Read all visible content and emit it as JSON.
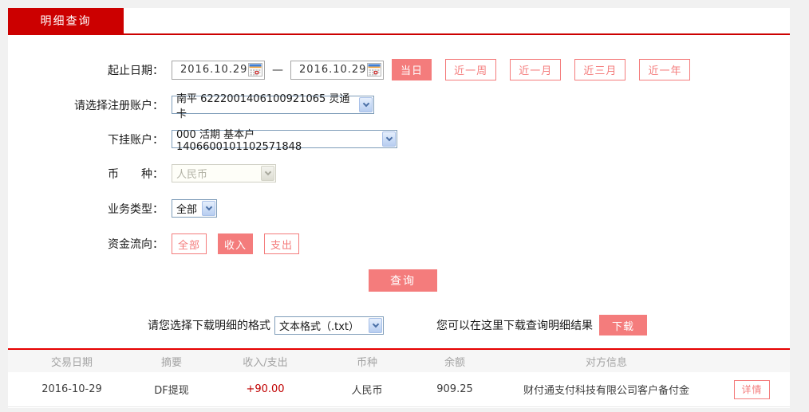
{
  "colors": {
    "brand_red": "#cc0000",
    "accent_pink": "#f47c7c",
    "income_red": "#c00000"
  },
  "tab": {
    "label": "明细查询"
  },
  "form": {
    "date": {
      "label": "起止日期：",
      "from": "2016.10.29",
      "to": "2016.10.29",
      "separator": "—"
    },
    "quick_ranges": [
      {
        "label": "当日",
        "active": true
      },
      {
        "label": "近一周",
        "active": false
      },
      {
        "label": "近一月",
        "active": false
      },
      {
        "label": "近三月",
        "active": false
      },
      {
        "label": "近一年",
        "active": false
      }
    ],
    "register_account": {
      "label": "请选择注册账户：",
      "value": "南平 6222001406100921065 灵通卡"
    },
    "sub_account": {
      "label": "下挂账户：",
      "value": "000 活期 基本户 1406600101102571848"
    },
    "currency": {
      "label": "币　　种：",
      "value": "人民币",
      "disabled": true
    },
    "business_type": {
      "label": "业务类型：",
      "value": "全部"
    },
    "fund_flow": {
      "label": "资金流向：",
      "options": [
        {
          "label": "全部",
          "active": false
        },
        {
          "label": "收入",
          "active": true
        },
        {
          "label": "支出",
          "active": false
        }
      ]
    },
    "query_button": "查询"
  },
  "download": {
    "format_label": "请您选择下载明细的格式",
    "format_value": "文本格式（.txt）",
    "hint": "您可以在这里下载查询明细结果",
    "button": "下载"
  },
  "table": {
    "headers": [
      "交易日期",
      "摘要",
      "收入/支出",
      "币种",
      "余额",
      "对方信息"
    ],
    "rows": [
      {
        "date": "2016-10-29",
        "summary": "DF提现",
        "amount": "+90.00",
        "currency": "人民币",
        "balance": "909.25",
        "counterparty": "财付通支付科技有限公司客户备付金",
        "detail_button": "详情"
      }
    ]
  }
}
